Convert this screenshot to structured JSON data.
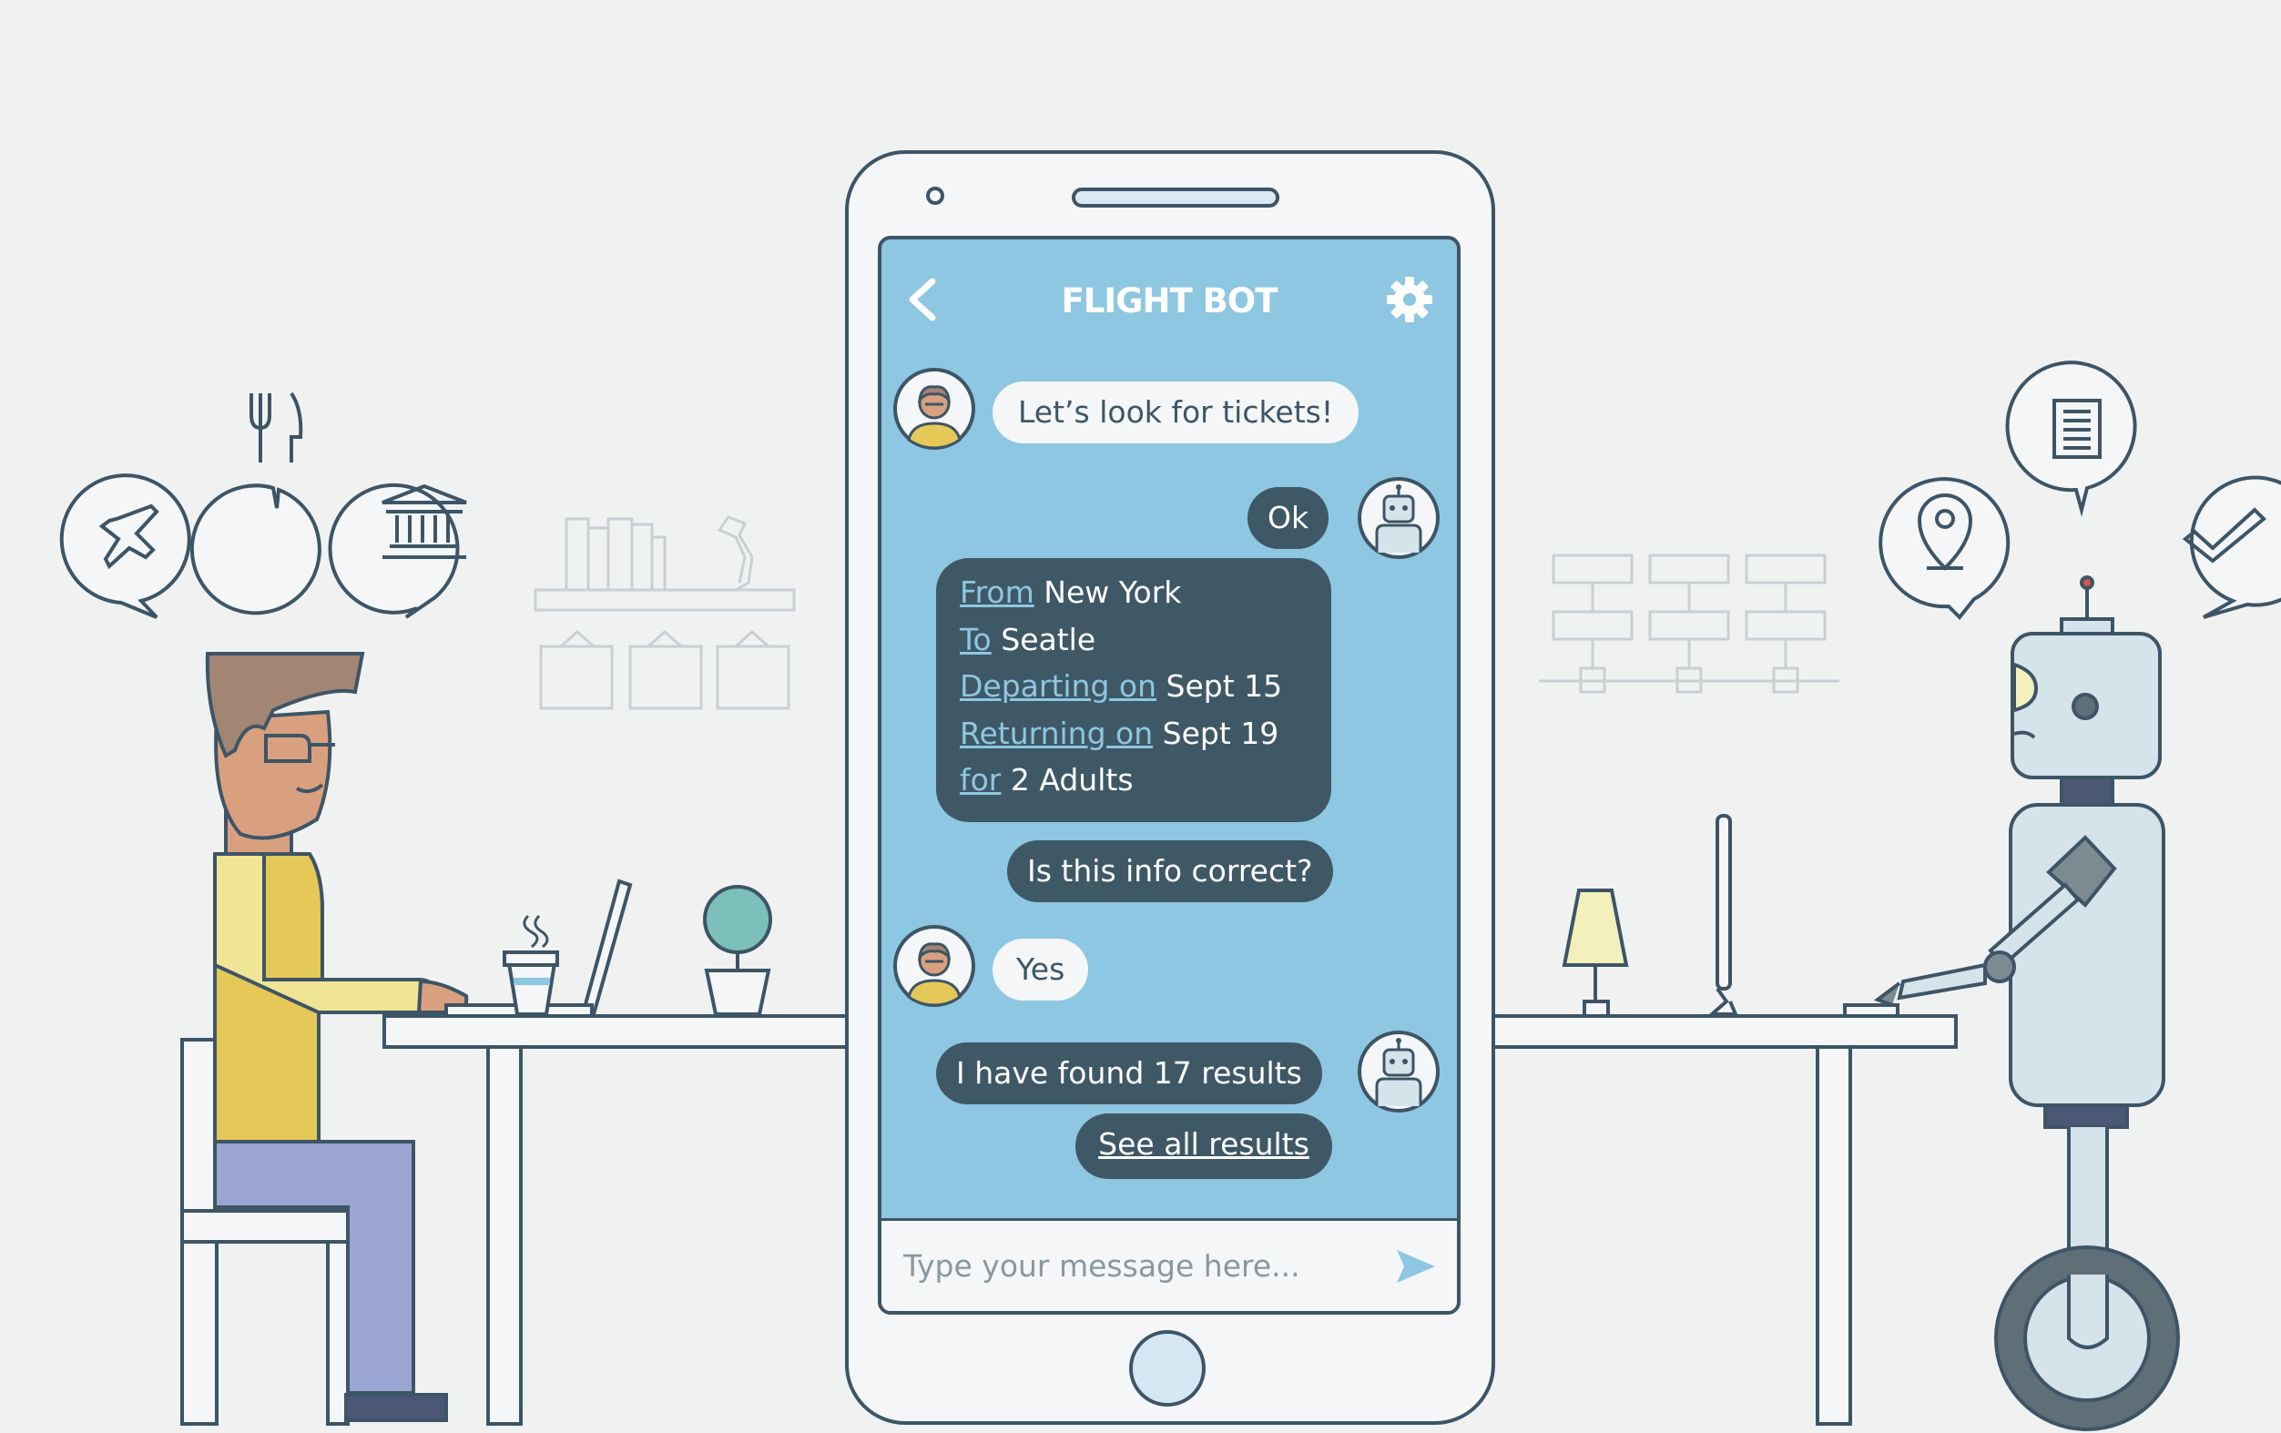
{
  "chat": {
    "title": "FLIGHT BOT",
    "messages": {
      "user_1": "Let’s look for tickets!",
      "bot_1": "Ok",
      "bot_3": "Is this info correct?",
      "user_2": "Yes",
      "bot_4": "I have found 17 results",
      "bot_5": "See all results"
    },
    "summary": {
      "from_label": "From",
      "from_value": "New York",
      "to_label": "To",
      "to_value": "Seatle",
      "depart_label": "Departing on",
      "depart_value": "Sept 15",
      "return_label": "Returning on",
      "return_value": "Sept 19",
      "pax_label": "for",
      "pax_value": "2 Adults"
    },
    "input": {
      "placeholder": "Type your message here..."
    }
  },
  "icons": {
    "header_left": "chevron-left-icon",
    "header_right": "gear-icon",
    "input_right": "send-icon",
    "left_bubbles": [
      "airplane-icon",
      "fork-knife-icon",
      "bank-icon"
    ],
    "right_bubbles": [
      "location-pin-icon",
      "document-icon",
      "checkmark-icon"
    ]
  },
  "colors": {
    "screen": "#8ec7e1",
    "bot_bubble": "#3f5866",
    "user_bubble": "#f4f6f7",
    "outline": "#3d5566",
    "background": "#f0f2f2"
  }
}
